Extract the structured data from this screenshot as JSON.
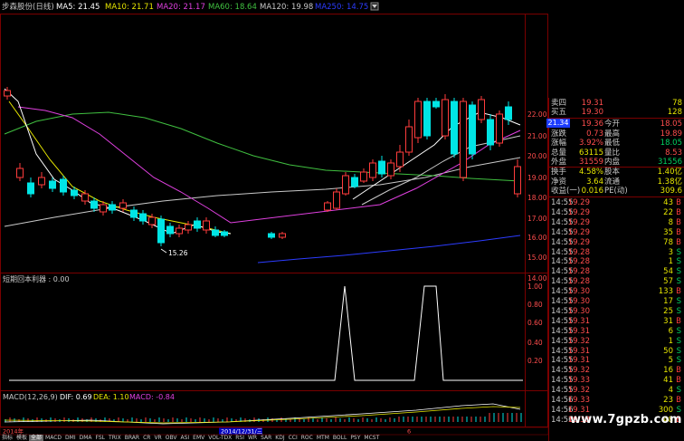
{
  "colors": {
    "up": "#ff3c3c",
    "down": "#00e5e5",
    "bg": "#000000",
    "grid": "#7a0000",
    "ma5": "#ffffff",
    "ma10": "#e6e600",
    "ma20": "#e040e0",
    "ma60": "#40c040",
    "ma120": "#c8c8c8",
    "ma250": "#2c3cff",
    "buy": "#ff3c3c",
    "sell": "#00d060"
  },
  "header": {
    "title": "步森股份(日线)",
    "ma5": "MA5: 21.45",
    "ma10": "MA10: 21.71",
    "ma20": "MA20: 21.17",
    "ma60": "MA60: 18.64",
    "ma120": "MA120: 19.98",
    "ma250": "MA250: 14.75"
  },
  "price_axis": {
    "labels": [
      "22.00",
      "21.00",
      "20.00",
      "19.00",
      "18.00",
      "17.00",
      "16.00",
      "15.00",
      "14.00"
    ],
    "current": "21.34"
  },
  "low_marker": "15.26",
  "indicator1": {
    "title": "短期回本利器 : 0.00",
    "ticks": [
      "1.00",
      "0.80",
      "0.60",
      "0.40",
      "0.20"
    ]
  },
  "macd": {
    "title": "MACD(12,26,9)",
    "dif": "DIF: 0.69",
    "dea": "DEA: 1.10",
    "macd": "MACD: -0.84"
  },
  "timeline": {
    "left": "2014年",
    "mid": "2014/12/31/三",
    "mark": "6"
  },
  "tabs": [
    "指标",
    "模板",
    "全部",
    "MACD",
    "DMI",
    "DMA",
    "FSL",
    "TRIX",
    "BRAR",
    "CR",
    "VR",
    "OBV",
    "ASI",
    "EMV",
    "VOL-TDX",
    "RSI",
    "WR",
    "SAR",
    "KDJ",
    "CCI",
    "ROC",
    "MTM",
    "BOLL",
    "PSY",
    "MCST"
  ],
  "quote": {
    "sell5": {
      "label": "卖四",
      "value": "19.31",
      "vol": "78"
    },
    "sell_label": {
      "label": "买五",
      "value": "19.30",
      "vol": "128"
    },
    "rows": [
      {
        "label": "现价",
        "value": "19.36",
        "l2": "今开",
        "v2": "18.05"
      },
      {
        "label": "涨跌",
        "value": "0.73",
        "l2": "最高",
        "v2": "19.89"
      },
      {
        "label": "涨幅",
        "value": "3.92%",
        "l2": "最低",
        "v2": "18.05"
      },
      {
        "label": "总量",
        "value": "63115",
        "l2": "量比",
        "v2": "8.53"
      },
      {
        "label": "外盘",
        "value": "31559",
        "l2": "内盘",
        "v2": "31556"
      }
    ],
    "rows2": [
      {
        "label": "换手",
        "value": "4.58%",
        "l2": "股本",
        "v2": "1.40亿"
      },
      {
        "label": "净资",
        "value": "3.64",
        "l2": "流通",
        "v2": "1.38亿"
      },
      {
        "label": "收益(一)",
        "value": "0.016",
        "l2": "PE(动)",
        "v2": "309.6"
      }
    ]
  },
  "ticks": [
    {
      "time": "14:55",
      "price": "19.29",
      "vol": "43",
      "side": "B"
    },
    {
      "time": "14:55",
      "price": "19.29",
      "vol": "22",
      "side": "B"
    },
    {
      "time": "14:55",
      "price": "19.29",
      "vol": "8",
      "side": "B"
    },
    {
      "time": "14:55",
      "price": "19.29",
      "vol": "35",
      "side": "B"
    },
    {
      "time": "14:55",
      "price": "19.29",
      "vol": "78",
      "side": "B"
    },
    {
      "time": "14:55",
      "price": "19.28",
      "vol": "3",
      "side": "S"
    },
    {
      "time": "14:55",
      "price": "19.28",
      "vol": "1",
      "side": "S"
    },
    {
      "time": "14:55",
      "price": "19.28",
      "vol": "54",
      "side": "S"
    },
    {
      "time": "14:55",
      "price": "19.28",
      "vol": "57",
      "side": "S"
    },
    {
      "time": "14:55",
      "price": "19.30",
      "vol": "133",
      "side": "B"
    },
    {
      "time": "14:55",
      "price": "19.30",
      "vol": "17",
      "side": "S"
    },
    {
      "time": "14:55",
      "price": "19.30",
      "vol": "25",
      "side": "S"
    },
    {
      "time": "14:55",
      "price": "19.31",
      "vol": "31",
      "side": "B"
    },
    {
      "time": "14:55",
      "price": "19.31",
      "vol": "6",
      "side": "S"
    },
    {
      "time": "14:55",
      "price": "19.32",
      "vol": "1",
      "side": "S"
    },
    {
      "time": "14:55",
      "price": "19.31",
      "vol": "50",
      "side": "S"
    },
    {
      "time": "14:55",
      "price": "19.31",
      "vol": "5",
      "side": "S"
    },
    {
      "time": "14:55",
      "price": "19.32",
      "vol": "16",
      "side": "B"
    },
    {
      "time": "14:55",
      "price": "19.33",
      "vol": "41",
      "side": "B"
    },
    {
      "time": "14:55",
      "price": "19.32",
      "vol": "4",
      "side": "S"
    },
    {
      "time": "14:56",
      "price": "19.33",
      "vol": "23",
      "side": "B"
    },
    {
      "time": "14:56",
      "price": "19.31",
      "vol": "300",
      "side": "S"
    },
    {
      "time": "14:56",
      "price": "19.38",
      "vol": "48",
      "side": "B"
    }
  ],
  "watermark": "www.7gpzb.com"
}
